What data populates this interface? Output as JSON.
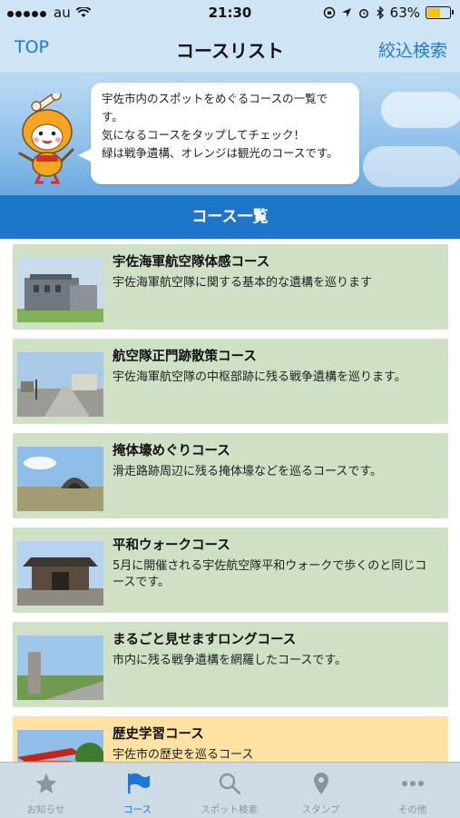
{
  "status_bar": {
    "carrier": "au",
    "time": "21:30",
    "battery_text": "63%",
    "battery_level": 0.63
  },
  "nav": {
    "left_button": "TOP",
    "title": "コースリスト",
    "right_button": "絞込検索"
  },
  "banner": {
    "lines": [
      "宇佐市内のスポットをめぐるコースの一覧です。",
      "気になるコースをタップしてチェック！",
      "緑は戦争遺構、オレンジは観光のコースです。"
    ]
  },
  "section_title": "コース一覧",
  "courses": [
    {
      "title": "宇佐海軍航空隊体感コース",
      "description": "宇佐海軍航空隊に関する基本的な遺構を巡ります",
      "category": "war"
    },
    {
      "title": "航空隊正門跡散策コース",
      "description": "宇佐海軍航空隊の中枢部跡に残る戦争遺構を巡ります。",
      "category": "war"
    },
    {
      "title": "掩体壕めぐりコース",
      "description": "滑走路跡周辺に残る掩体壕などを巡るコースです。",
      "category": "war"
    },
    {
      "title": "平和ウォークコース",
      "description": "5月に開催される宇佐航空隊平和ウォークで歩くのと同じコースです。",
      "category": "war"
    },
    {
      "title": "まるごと見せますロングコース",
      "description": "市内に残る戦争遺構を網羅したコースです。",
      "category": "war"
    },
    {
      "title": "歴史学習コース",
      "description": "宇佐市の歴史を巡るコース",
      "category": "sightseeing"
    }
  ],
  "colors": {
    "war": "#cfe0c5",
    "sightseeing": "#fde2a4",
    "accent": "#1e76c8"
  },
  "tabs": [
    {
      "label": "お知らせ",
      "icon": "star-icon"
    },
    {
      "label": "コース",
      "icon": "flag-icon",
      "active": true
    },
    {
      "label": "スポット検索",
      "icon": "search-icon"
    },
    {
      "label": "スタンプ",
      "icon": "map-pin-icon"
    },
    {
      "label": "その他",
      "icon": "more-icon"
    }
  ]
}
